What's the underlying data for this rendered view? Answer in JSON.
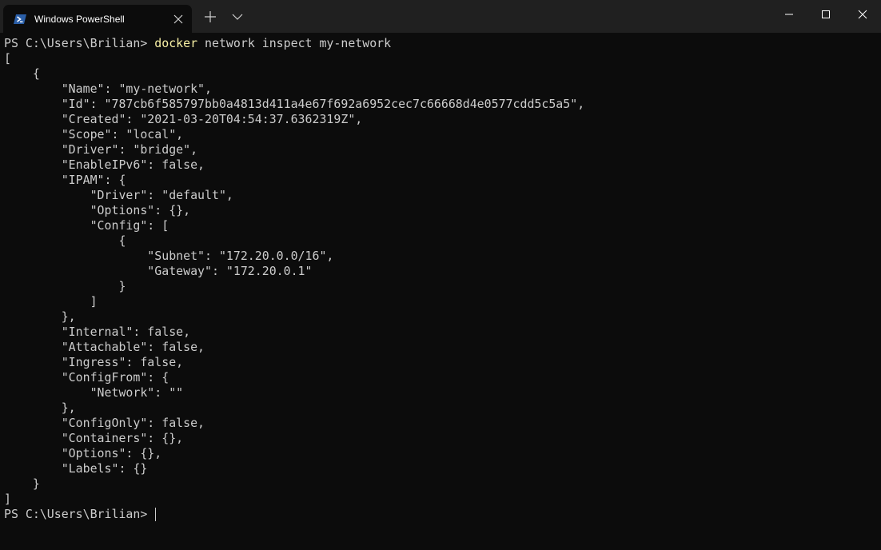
{
  "window": {
    "tab_title": "Windows PowerShell",
    "icons": {
      "tab_icon": "powershell-icon",
      "tab_close": "close-icon",
      "new_tab": "plus-icon",
      "dropdown": "chevron-down-icon",
      "minimize": "minimize-icon",
      "maximize": "maximize-icon",
      "close": "close-icon"
    }
  },
  "terminal": {
    "prompt": "PS C:\\Users\\Brilian> ",
    "command_name": "docker",
    "command_args": " network inspect my-network",
    "output_lines": [
      "[",
      "    {",
      "        \"Name\": \"my-network\",",
      "        \"Id\": \"787cb6f585797bb0a4813d411a4e67f692a6952cec7c66668d4e0577cdd5c5a5\",",
      "        \"Created\": \"2021-03-20T04:54:37.6362319Z\",",
      "        \"Scope\": \"local\",",
      "        \"Driver\": \"bridge\",",
      "        \"EnableIPv6\": false,",
      "        \"IPAM\": {",
      "            \"Driver\": \"default\",",
      "            \"Options\": {},",
      "            \"Config\": [",
      "                {",
      "                    \"Subnet\": \"172.20.0.0/16\",",
      "                    \"Gateway\": \"172.20.0.1\"",
      "                }",
      "            ]",
      "        },",
      "        \"Internal\": false,",
      "        \"Attachable\": false,",
      "        \"Ingress\": false,",
      "        \"ConfigFrom\": {",
      "            \"Network\": \"\"",
      "        },",
      "        \"ConfigOnly\": false,",
      "        \"Containers\": {},",
      "        \"Options\": {},",
      "        \"Labels\": {}",
      "    }",
      "]"
    ],
    "final_prompt": "PS C:\\Users\\Brilian> "
  },
  "colors": {
    "background": "#0c0c0c",
    "titlebar": "#202020",
    "text": "#cccccc",
    "command_highlight": "#f9f1a5",
    "powershell_icon": "#2b5fa8"
  }
}
